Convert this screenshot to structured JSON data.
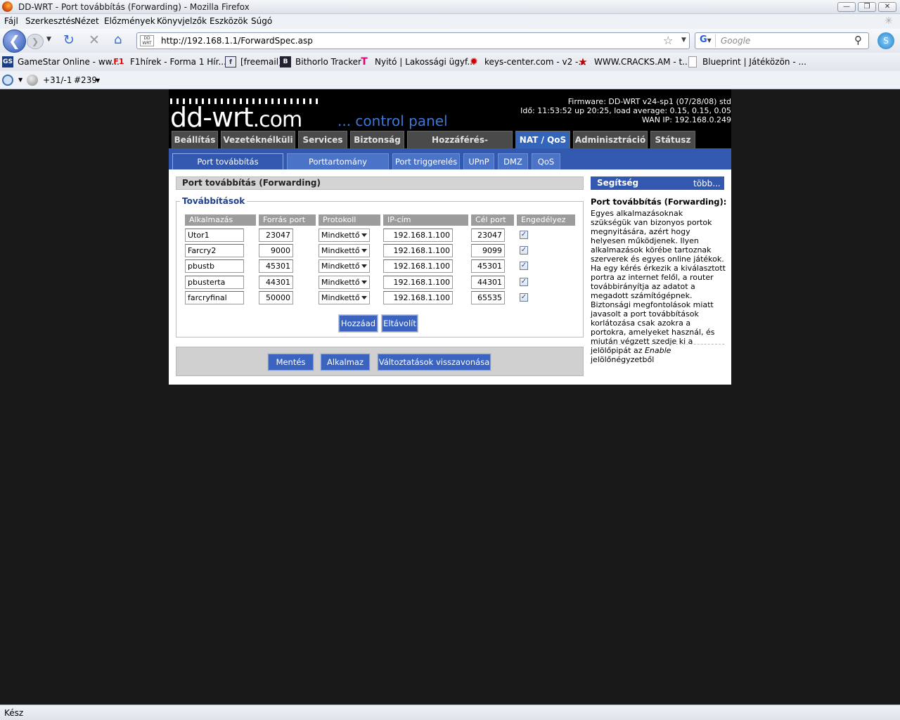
{
  "window": {
    "title": "DD-WRT - Port továbbítás (Forwarding) - Mozilla Firefox"
  },
  "menu": [
    "Fájl",
    "Szerkesztés",
    "Nézet",
    "Előzmények",
    "Könyvjelzők",
    "Eszközök",
    "Súgó"
  ],
  "nav": {
    "url": "http://192.168.1.1/ForwardSpec.asp",
    "search_placeholder": "Google"
  },
  "bookmarks": [
    "GameStar Online - ww...",
    "F1hírek - Forma 1 Hír...",
    "[freemail]",
    "Bithorlo Tracker",
    "Nyitó | Lakossági ügyf...",
    "keys-center.com - v2 -...",
    "WWW.CRACKS.AM - t...",
    "Blueprint | Játéközön - ..."
  ],
  "addon": {
    "score": "+31/-1",
    "count": "#239"
  },
  "router": {
    "firmware": "Firmware: DD-WRT v24-sp1 (07/28/08) std",
    "time": "Idő: 11:53:52 up 20:25, load average: 0.15, 0.15, 0.05",
    "wan": "WAN IP: 192.168.0.249",
    "logo_main": "dd-wrt",
    "logo_com": ".com",
    "logo_cp": "... control panel"
  },
  "tabs": [
    "Beállítás",
    "Vezetéknélküli",
    "Services",
    "Biztonság",
    "Hozzáférés-korlátozás",
    "NAT / QoS",
    "Adminisztráció",
    "Státusz"
  ],
  "subtabs": [
    "Port továbbítás (forwarding)",
    "Porttartomány továbbítás",
    "Port triggerelés",
    "UPnP",
    "DMZ",
    "QoS"
  ],
  "section": {
    "title": "Port továbbítás (Forwarding)",
    "legend": "Továbbítások",
    "headers": [
      "Alkalmazás",
      "Forrás port",
      "Protokoll",
      "IP-cím",
      "Cél port",
      "Engedélyez"
    ],
    "rows": [
      {
        "app": "Utor1",
        "src": "23047",
        "proto": "Mindkettő",
        "ip": "192.168.1.100",
        "dst": "23047",
        "enabled": "✓"
      },
      {
        "app": "Farcry2",
        "src": "9000",
        "proto": "Mindkettő",
        "ip": "192.168.1.100",
        "dst": "9099",
        "enabled": "✓"
      },
      {
        "app": "pbustb",
        "src": "45301",
        "proto": "Mindkettő",
        "ip": "192.168.1.100",
        "dst": "45301",
        "enabled": "✓"
      },
      {
        "app": "pbusterta",
        "src": "44301",
        "proto": "Mindkettő",
        "ip": "192.168.1.100",
        "dst": "44301",
        "enabled": "✓"
      },
      {
        "app": "farcryfinal",
        "src": "50000",
        "proto": "Mindkettő",
        "ip": "192.168.1.100",
        "dst": "65535",
        "enabled": "✓"
      }
    ],
    "add_label": "Hozzáad",
    "remove_label": "Eltávolít"
  },
  "actions": {
    "save": "Mentés",
    "apply": "Alkalmaz",
    "revert": "Változtatások visszavonása"
  },
  "help": {
    "header": "Segítség",
    "more": "több...",
    "title": "Port továbbítás (Forwarding):",
    "text": "Egyes alkalmazásoknak szükségük van bizonyos portok megnyitására, azért hogy helyesen működjenek. Ilyen alkalmazások körébe tartoznak szerverek és egyes online játékok. Ha egy kérés érkezik a kiválasztott portra az internet felől, a router továbbirányítja az adatot a megadott számítógépnek. Biztonsági megfontolások miatt javasolt a port továbbítások korlátozása csak azokra a portokra, amelyeket használ, és miután végzett szedje ki a jelölőpipát az",
    "text_em": "Enable",
    "text_end": " jelölőnégyzetből"
  },
  "status": "Kész"
}
